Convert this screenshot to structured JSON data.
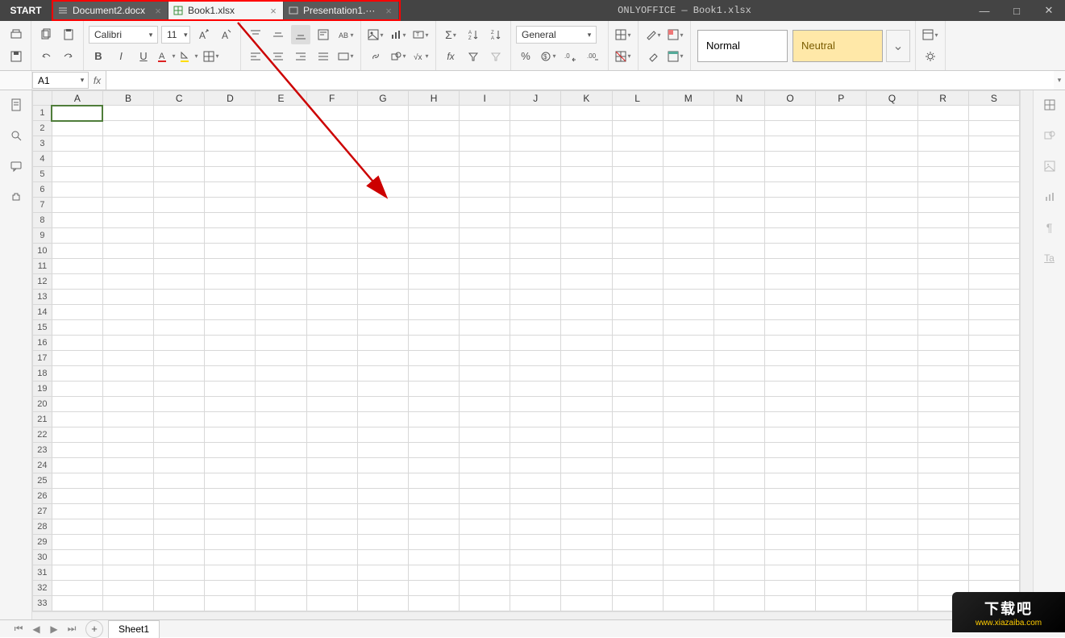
{
  "title": "ONLYOFFICE — Book1.xlsx",
  "start": "START",
  "tabs": [
    {
      "label": "Document2.docx"
    },
    {
      "label": "Book1.xlsx"
    },
    {
      "label": "Presentation1.···"
    }
  ],
  "toolbar": {
    "font": "Calibri",
    "size": "11",
    "numfmt": "General"
  },
  "styles": {
    "normal": "Normal",
    "neutral": "Neutral"
  },
  "namebox": "A1",
  "formula": "",
  "columns": [
    "A",
    "B",
    "C",
    "D",
    "E",
    "F",
    "G",
    "H",
    "I",
    "J",
    "K",
    "L",
    "M",
    "N",
    "O",
    "P",
    "Q",
    "R",
    "S"
  ],
  "rowcount": 33,
  "sheet": "Sheet1",
  "watermark": {
    "line1": "下载吧",
    "line2": "www.xiazaiba.com"
  }
}
